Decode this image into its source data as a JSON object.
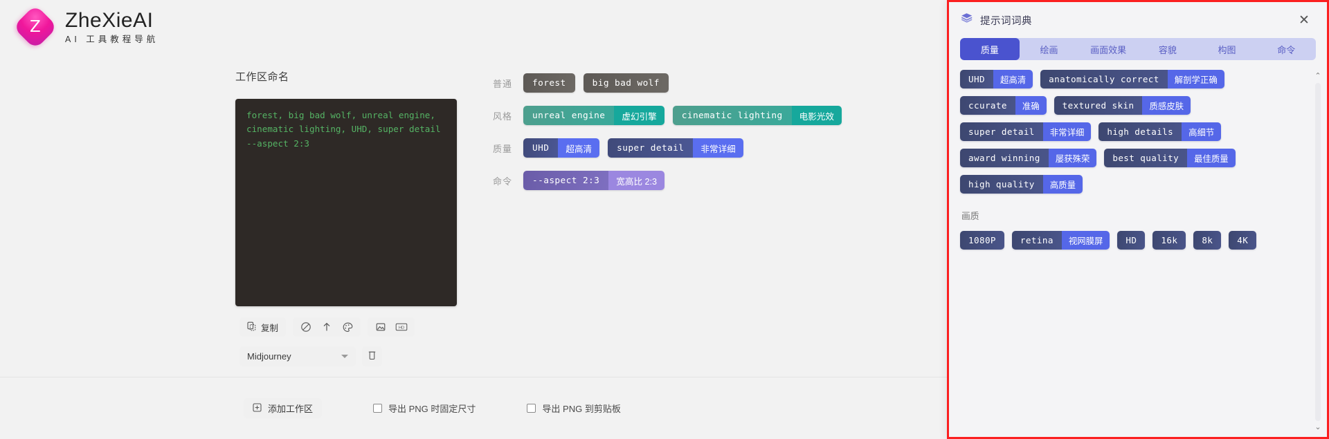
{
  "brand": {
    "mark_letter": "Z",
    "title": "ZheXieAI",
    "subtitle": "AI 工具教程导航"
  },
  "workspace": {
    "label": "工作区命名",
    "prompt_text": "forest, big bad wolf, unreal engine, cinematic lighting, UHD, super detail --aspect 2:3",
    "copy_label": "复制",
    "icons": [
      {
        "name": "no-entry-icon",
        "glyph": "⊘"
      },
      {
        "name": "arrow-up-icon",
        "glyph": "↑"
      },
      {
        "name": "palette-icon",
        "glyph": "◌"
      },
      {
        "name": "image-icon",
        "glyph": "▣"
      },
      {
        "name": "hd-icon",
        "glyph": "HD"
      }
    ],
    "model_select": "Midjourney",
    "delete_title": "删除"
  },
  "tag_rows": [
    {
      "label": "普通",
      "variant": "plain",
      "tags": [
        {
          "en": "forest",
          "zh": ""
        },
        {
          "en": "big bad wolf",
          "zh": ""
        }
      ]
    },
    {
      "label": "风格",
      "variant": "style",
      "tags": [
        {
          "en": "unreal engine",
          "zh": "虚幻引擎"
        },
        {
          "en": "cinematic lighting",
          "zh": "电影光效"
        }
      ]
    },
    {
      "label": "质量",
      "variant": "quality",
      "tags": [
        {
          "en": "UHD",
          "zh": "超高清"
        },
        {
          "en": "super detail",
          "zh": "非常详细"
        }
      ]
    },
    {
      "label": "命令",
      "variant": "command",
      "tags": [
        {
          "en": "--aspect 2:3",
          "zh": "宽高比 2:3"
        }
      ]
    }
  ],
  "bottom_bar": {
    "add_workspace": "添加工作区",
    "checkbox_fixed_size": "导出 PNG 时固定尺寸",
    "checkbox_clipboard": "导出 PNG 到剪贴板"
  },
  "dictionary": {
    "title": "提示词词典",
    "close_glyph": "✕",
    "tabs": [
      {
        "label": "质量",
        "active": true
      },
      {
        "label": "绘画",
        "active": false
      },
      {
        "label": "画面效果",
        "active": false
      },
      {
        "label": "容貌",
        "active": false
      },
      {
        "label": "构图",
        "active": false
      },
      {
        "label": "命令",
        "active": false
      }
    ],
    "groups": [
      {
        "title": "",
        "tags": [
          {
            "en": "UHD",
            "zh": "超高清"
          },
          {
            "en": "anatomically correct",
            "zh": "解剖学正确"
          },
          {
            "en": "ccurate",
            "zh": "准确"
          },
          {
            "en": "textured skin",
            "zh": "质感皮肤"
          },
          {
            "en": "super detail",
            "zh": "非常详细"
          },
          {
            "en": "high details",
            "zh": "高细节"
          },
          {
            "en": "award winning",
            "zh": "屡获殊荣"
          },
          {
            "en": "best quality",
            "zh": "最佳质量"
          },
          {
            "en": "high quality",
            "zh": "高质量"
          }
        ]
      },
      {
        "title": "画质",
        "tags": [
          {
            "en": "1080P",
            "zh": ""
          },
          {
            "en": "retina",
            "zh": "视网膜屏"
          },
          {
            "en": "HD",
            "zh": ""
          },
          {
            "en": "16k",
            "zh": ""
          },
          {
            "en": "8k",
            "zh": ""
          },
          {
            "en": "4K",
            "zh": ""
          }
        ]
      }
    ],
    "scroll_up_glyph": "⌃",
    "scroll_down_glyph": "⌄"
  },
  "colors": {
    "accent_red_border": "#fb1f20",
    "tab_active": "#4a53cf",
    "tab_bar": "#ccd0f2",
    "prompt_bg": "#2e2926",
    "prompt_text": "#55b364"
  }
}
